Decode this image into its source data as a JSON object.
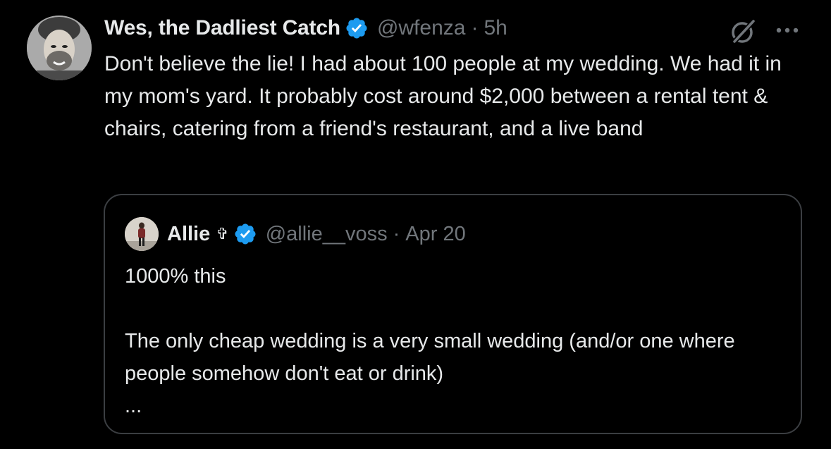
{
  "tweet": {
    "display_name": "Wes, the Dadliest Catch",
    "handle": "@wfenza",
    "separator": "·",
    "time": "5h",
    "text": "Don't believe the lie! I had about 100 people at my wedding. We had it in my mom's yard. It probably cost around $2,000 between a rental tent & chairs, catering from a friend's restaurant, and a live band",
    "icons": {
      "verified": "verified-badge-icon",
      "grok": "grok-icon",
      "more": "more-options-icon"
    }
  },
  "quoted_tweet": {
    "display_name": "Allie",
    "name_emoji": "✞",
    "handle": "@allie__voss",
    "separator": "·",
    "time": "Apr 20",
    "paragraphs": [
      "1000% this",
      "The only cheap wedding is a very small wedding (and/or one where people somehow don't eat or drink)",
      "..."
    ]
  },
  "colors": {
    "background": "#000000",
    "text": "#e7e9ea",
    "secondary_text": "#71767b",
    "verified_blue": "#1d9bf0",
    "card_border": "#3b3e42"
  }
}
